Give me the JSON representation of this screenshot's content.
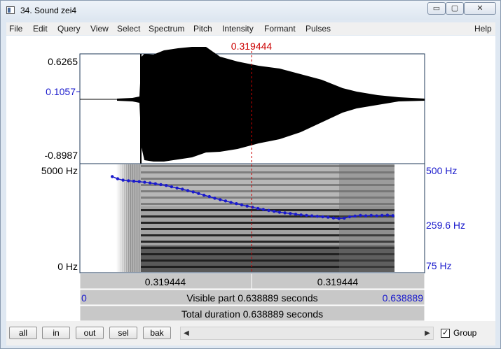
{
  "window": {
    "title": "34. Sound zei4",
    "minimize_glyph": "▭",
    "maximize_glyph": "▢",
    "close_glyph": "✕"
  },
  "menu": {
    "items": [
      "File",
      "Edit",
      "Query",
      "View",
      "Select",
      "Spectrum",
      "Pitch",
      "Intensity",
      "Formant",
      "Pulses"
    ],
    "help": "Help"
  },
  "cursor": {
    "time_label": "0.319444"
  },
  "waveform": {
    "ymax": "0.6265",
    "ymid": "0.1057",
    "ymin": "-0.8987"
  },
  "spectrogram": {
    "freq_max": "5000 Hz",
    "freq_min": "0 Hz"
  },
  "pitch": {
    "max": "500 Hz",
    "mid": "259.6 Hz",
    "min": "75 Hz",
    "color": "#1a1acc"
  },
  "chart_data": {
    "type": "line",
    "title": "",
    "xlabel": "",
    "ylabel": "",
    "xlim": [
      0,
      0.638889
    ],
    "ylim": [
      75,
      500
    ],
    "scale": "log",
    "series": [
      {
        "x": [
          0.06,
          0.07,
          0.08,
          0.09,
          0.1,
          0.11,
          0.12,
          0.13,
          0.14,
          0.15,
          0.16,
          0.17,
          0.18,
          0.19,
          0.2,
          0.21,
          0.22,
          0.23,
          0.24,
          0.25,
          0.26,
          0.27,
          0.28,
          0.29,
          0.3,
          0.31,
          0.32,
          0.33,
          0.34,
          0.35,
          0.36,
          0.37,
          0.38,
          0.39,
          0.4,
          0.41,
          0.42,
          0.43,
          0.44,
          0.45,
          0.46,
          0.47,
          0.48,
          0.49,
          0.5,
          0.51,
          0.52,
          0.53,
          0.54,
          0.55,
          0.56,
          0.57,
          0.58
        ],
        "y": [
          470,
          450,
          438,
          433,
          429,
          425,
          420,
          414,
          408,
          401,
          394,
          384,
          375,
          366,
          356,
          347,
          336,
          325,
          316,
          306,
          298,
          290,
          282,
          275,
          268,
          262,
          256,
          250,
          245,
          240,
          236,
          232,
          229,
          226,
          223,
          220,
          218,
          216,
          214,
          212,
          210,
          207,
          205,
          206,
          212,
          215,
          218,
          216,
          218,
          216,
          218,
          219,
          217
        ]
      }
    ]
  },
  "time_bar": {
    "left": "0.319444",
    "right": "0.319444",
    "start": "0",
    "end": "0.638889",
    "visible": "Visible part 0.638889 seconds",
    "total": "Total duration 0.638889 seconds"
  },
  "buttons": {
    "all": "all",
    "in": "in",
    "out": "out",
    "sel": "sel",
    "bak": "bak"
  },
  "scroll": {
    "left_arrow": "◀",
    "right_arrow": "▶"
  },
  "group": {
    "label": "Group",
    "check": "✓"
  }
}
